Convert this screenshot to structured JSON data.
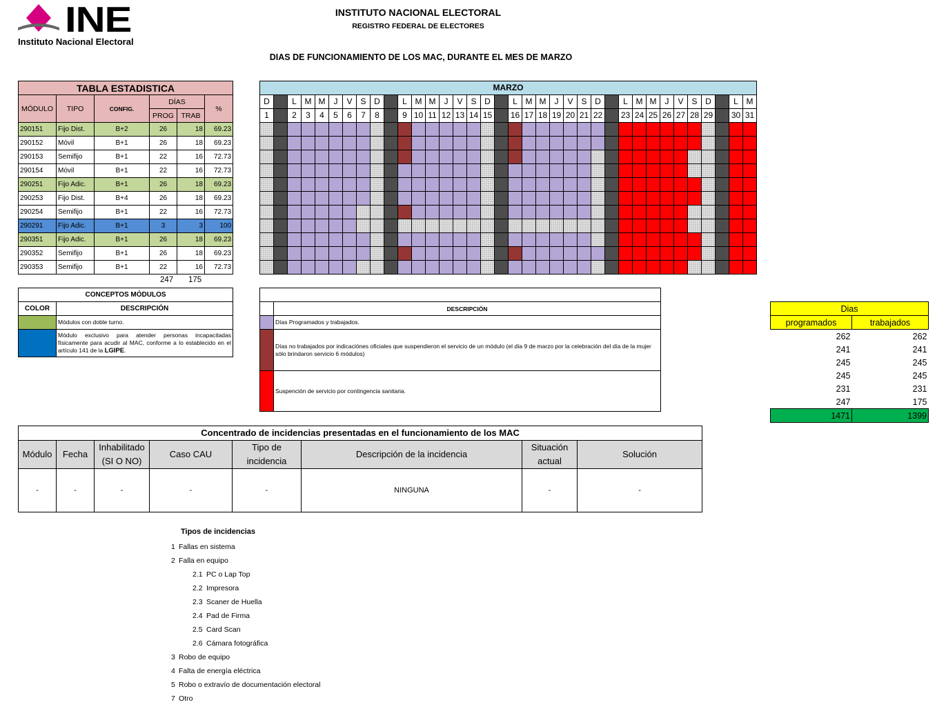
{
  "logo": {
    "abbr": "INE",
    "subtitle": "Instituto Nacional Electoral"
  },
  "header": {
    "title": "INSTITUTO NACIONAL ELECTORAL",
    "subtitle": "REGISTRO FEDERAL DE ELECTORES",
    "report_title": "DIAS DE FUNCIONAMIENTO DE LOS MAC, DURANTE EL MES DE MARZO"
  },
  "stats": {
    "title": "TABLA ESTADISTICA",
    "headers": {
      "modulo": "MÓDULO",
      "tipo": "TIPO",
      "config": "CONFIG.",
      "dias": "DÍAS",
      "prog": "PROG",
      "trab": "TRAB",
      "pct": "%"
    },
    "rows": [
      {
        "modulo": "290151",
        "tipo": "Fijo Dist.",
        "config": "B+2",
        "prog": "26",
        "trab": "18",
        "pct": "69.23",
        "hl": "green"
      },
      {
        "modulo": "290152",
        "tipo": "Móvil",
        "config": "B+1",
        "prog": "26",
        "trab": "18",
        "pct": "69.23",
        "hl": ""
      },
      {
        "modulo": "290153",
        "tipo": "Semifijo",
        "config": "B+1",
        "prog": "22",
        "trab": "16",
        "pct": "72.73",
        "hl": ""
      },
      {
        "modulo": "290154",
        "tipo": "Móvil",
        "config": "B+1",
        "prog": "22",
        "trab": "16",
        "pct": "72.73",
        "hl": ""
      },
      {
        "modulo": "290251",
        "tipo": "Fijo Adic.",
        "config": "B+1",
        "prog": "26",
        "trab": "18",
        "pct": "69.23",
        "hl": "green"
      },
      {
        "modulo": "290253",
        "tipo": "Fijo Dist.",
        "config": "B+4",
        "prog": "26",
        "trab": "18",
        "pct": "69.23",
        "hl": ""
      },
      {
        "modulo": "290254",
        "tipo": "Semifijo",
        "config": "B+1",
        "prog": "22",
        "trab": "16",
        "pct": "72.73",
        "hl": ""
      },
      {
        "modulo": "290291",
        "tipo": "Fijo Adic.",
        "config": "B+1",
        "prog": "3",
        "trab": "3",
        "pct": "100",
        "hl": "blue"
      },
      {
        "modulo": "290351",
        "tipo": "Fijo Adic.",
        "config": "B+1",
        "prog": "26",
        "trab": "18",
        "pct": "69.23",
        "hl": "green"
      },
      {
        "modulo": "290352",
        "tipo": "Semifijo",
        "config": "B+1",
        "prog": "26",
        "trab": "18",
        "pct": "69.23",
        "hl": ""
      },
      {
        "modulo": "290353",
        "tipo": "Semifijo",
        "config": "B+1",
        "prog": "22",
        "trab": "16",
        "pct": "72.73",
        "hl": ""
      }
    ],
    "total_prog": "247",
    "total_trab": "175"
  },
  "calendar": {
    "title": "MARZO",
    "weekdays": [
      "D",
      "",
      "L",
      "M",
      "M",
      "J",
      "V",
      "S",
      "D",
      "",
      "L",
      "M",
      "M",
      "J",
      "V",
      "S",
      "D",
      "",
      "L",
      "M",
      "M",
      "J",
      "V",
      "S",
      "D",
      "",
      "L",
      "M",
      "M",
      "J",
      "V",
      "S",
      "D",
      "",
      "L",
      "M"
    ],
    "days": [
      "1",
      "",
      "2",
      "3",
      "4",
      "5",
      "6",
      "7",
      "8",
      "",
      "9",
      "10",
      "11",
      "12",
      "13",
      "14",
      "15",
      "",
      "16",
      "17",
      "18",
      "19",
      "20",
      "21",
      "22",
      "",
      "23",
      "24",
      "25",
      "26",
      "27",
      "28",
      "29",
      "",
      "30",
      "31"
    ],
    "legend": {
      "p": "programado y trabajado",
      "h": "no programado",
      "x": "separador de semana",
      "m": "no trabajado por indicación oficial",
      "r": "suspensión por contingencia sanitaria"
    },
    "rows": [
      "hxpppppphxmppppphxmpppppphxrrrrrrhxrr",
      "hxpppppphxmppppphxmpppppphxrrrrrrhxrr",
      "hxpppppphhxmppppphhxmppppphhxrrrrrhhxrr",
      "hxpppppphhxpppppphhxpppppphhxrrrrrhhxrr",
      "hxpppppphxpppppphxpppppphxrrrrrrhxrr",
      "hxpppppphxpppppphxpppppphxrrrrrrhxrr",
      "hxppppphhxmppppphhxpppppphhxrrrrrhhxrr",
      "hxppppphhxhhhhhhhhxhhhhhhhhxrrrrrhhxrr",
      "hxpppppphxpppppphxpppppphxrrrrrrhxrr",
      "hxpppppphxmppppphxmpppppphxrrrrrrhxrr",
      "hxppppphhxpppppphhxpppppphhxrrrrrhhxrr"
    ]
  },
  "conceptos": {
    "title": "CONCEPTOS MÓDULOS",
    "col_color": "COLOR",
    "col_desc": "DESCRIPCIÓN",
    "items": [
      {
        "color": "#9bbb59",
        "text": "Módulos con doble turno."
      },
      {
        "color": "#0070c0",
        "text": "Módulo exclusivo para atender personas incapacitadas físicamente para acudir al MAC, conforme a lo establecido en el artículo 141 de la ",
        "bold": "LGIPE",
        "end": "."
      }
    ]
  },
  "descripcion": {
    "header": "DESCRIPCIÓN",
    "items": [
      {
        "color": "#b4a7d6",
        "text": "Días Programados y trabajados."
      },
      {
        "color": "#963634",
        "text": "Días no trabajados por indicaciónes oficiales que suspendieron el servicio de un módulo (el día 9 de marzo por la celebración del día de la mujer sólo brindaron servicio 6 módulos)"
      },
      {
        "color": "#ff0000",
        "text": "Suspención de servicio por contingencia sanitaria."
      }
    ]
  },
  "dias_box": {
    "title": "Dias",
    "col1": "programados",
    "col2": "trabajados",
    "rows": [
      [
        "262",
        "262"
      ],
      [
        "241",
        "241"
      ],
      [
        "245",
        "245"
      ],
      [
        "245",
        "245"
      ],
      [
        "231",
        "231"
      ],
      [
        "247",
        "175"
      ]
    ],
    "total": [
      "1471",
      "1399"
    ]
  },
  "incidencias": {
    "title": "Concentrado de incidencias presentadas en el funcionamiento de los MAC",
    "headers": [
      "Módulo",
      "Fecha",
      "Inhabilitado (SI O NO)",
      "Caso CAU",
      "Tipo de incidencia",
      "Descripción de la incidencia",
      "Situación actual",
      "Solución"
    ],
    "row": [
      "-",
      "-",
      "-",
      "-",
      "-",
      "NINGUNA",
      "-",
      "-"
    ]
  },
  "tipos": {
    "title": "Tipos de incidencias",
    "items": [
      {
        "num": "1",
        "label": "Fallas en sistema",
        "level": 0
      },
      {
        "num": "2",
        "label": "Falla en equipo",
        "level": 0
      },
      {
        "num": "2.1",
        "label": "PC o Lap Top",
        "level": 1
      },
      {
        "num": "2.2",
        "label": "Impresora",
        "level": 1
      },
      {
        "num": "2.3",
        "label": "Scaner de Huella",
        "level": 1
      },
      {
        "num": "2.4",
        "label": "Pad de Firma",
        "level": 1
      },
      {
        "num": "2.5",
        "label": "Card Scan",
        "level": 1
      },
      {
        "num": "2.6",
        "label": "Cámara fotográfica",
        "level": 1
      },
      {
        "num": "3",
        "label": "Robo de equipo",
        "level": 0
      },
      {
        "num": "4",
        "label": "Falta de energía  eléctrica",
        "level": 0
      },
      {
        "num": "5",
        "label": "Robo o extravío de documentación electoral",
        "level": 0
      },
      {
        "num": "7",
        "label": "Otro",
        "level": 0
      }
    ]
  }
}
